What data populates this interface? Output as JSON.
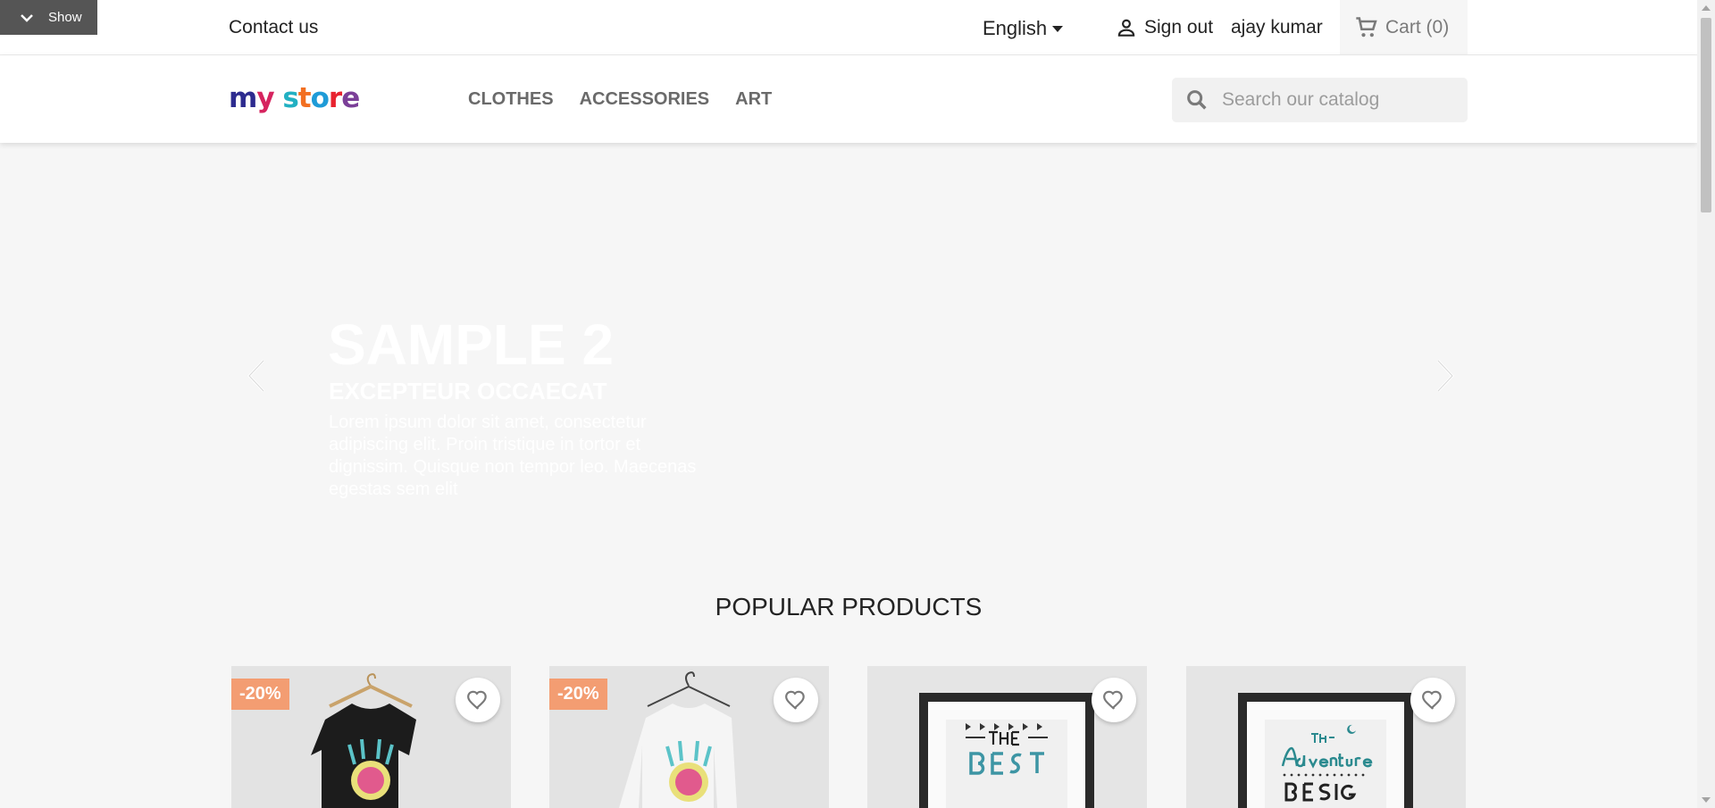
{
  "debug_toggle": {
    "label": "Show"
  },
  "topbar": {
    "contact": "Contact us",
    "language": "English",
    "sign_out": "Sign out",
    "user_name": "ajay kumar",
    "cart": "Cart",
    "cart_count": "(0)"
  },
  "header": {
    "logo_text": [
      "m",
      "y",
      " ",
      "s",
      "t",
      "o",
      "r",
      "e"
    ],
    "nav": [
      "CLOTHES",
      "ACCESSORIES",
      "ART"
    ],
    "search_placeholder": "Search our catalog"
  },
  "slider": {
    "title": "SAMPLE 2",
    "subtitle": "EXCEPTEUR OCCAECAT",
    "text": "Lorem ipsum dolor sit amet, consectetur adipiscing elit. Proin tristique in tortor et dignissim. Quisque non tempor leo. Maecenas egestas sem elit"
  },
  "section_title": "POPULAR PRODUCTS",
  "products": [
    {
      "badge": "-20%",
      "image": "black-tshirt-hummingbird"
    },
    {
      "badge": "-20%",
      "image": "white-sweater-hummingbird"
    },
    {
      "badge": "",
      "image": "framed-poster-the-best"
    },
    {
      "badge": "",
      "image": "framed-poster-the-adventure-begins"
    }
  ],
  "colors": {
    "discount_badge": "#f39d72",
    "cart_bg": "#f6f6f6",
    "debug_toggle_bg": "#555555"
  }
}
